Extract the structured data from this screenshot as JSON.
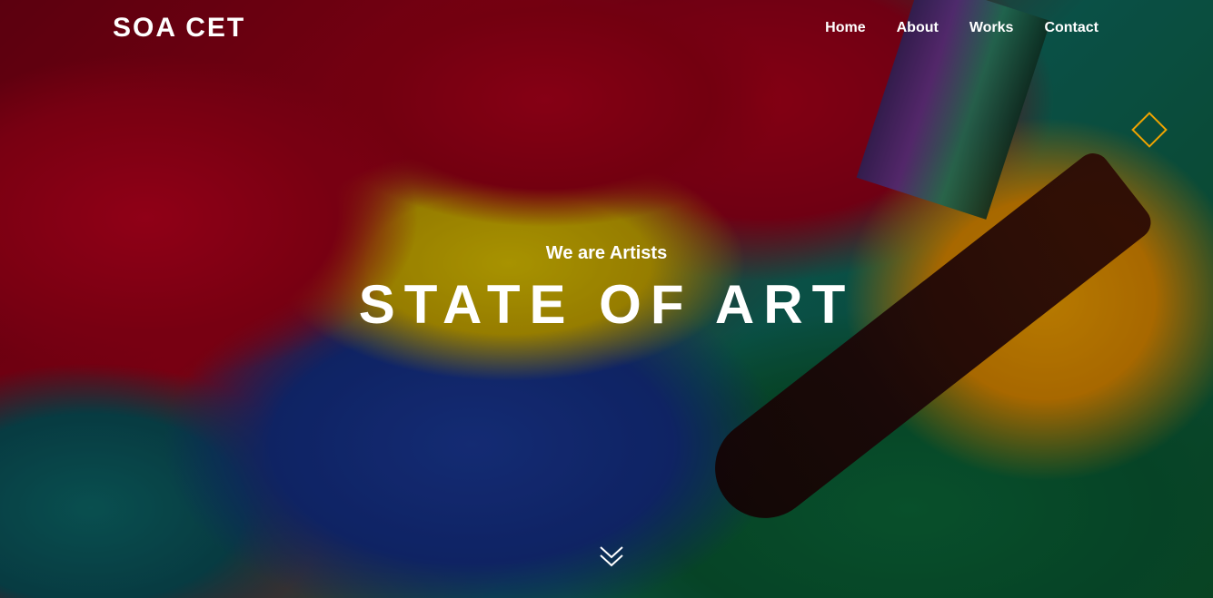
{
  "header": {
    "brand": "SOA CET",
    "nav": [
      {
        "label": "Home"
      },
      {
        "label": "About"
      },
      {
        "label": "Works"
      },
      {
        "label": "Contact"
      }
    ]
  },
  "hero": {
    "subtitle": "We are Artists",
    "title": "STATE OF ART",
    "background_image": "paint-brush-mixing-paint"
  },
  "icons": {
    "diamond": "diamond-icon",
    "scroll": "chevron-double-down-icon"
  },
  "colors": {
    "accent": "#f0a400",
    "text": "#ffffff"
  }
}
